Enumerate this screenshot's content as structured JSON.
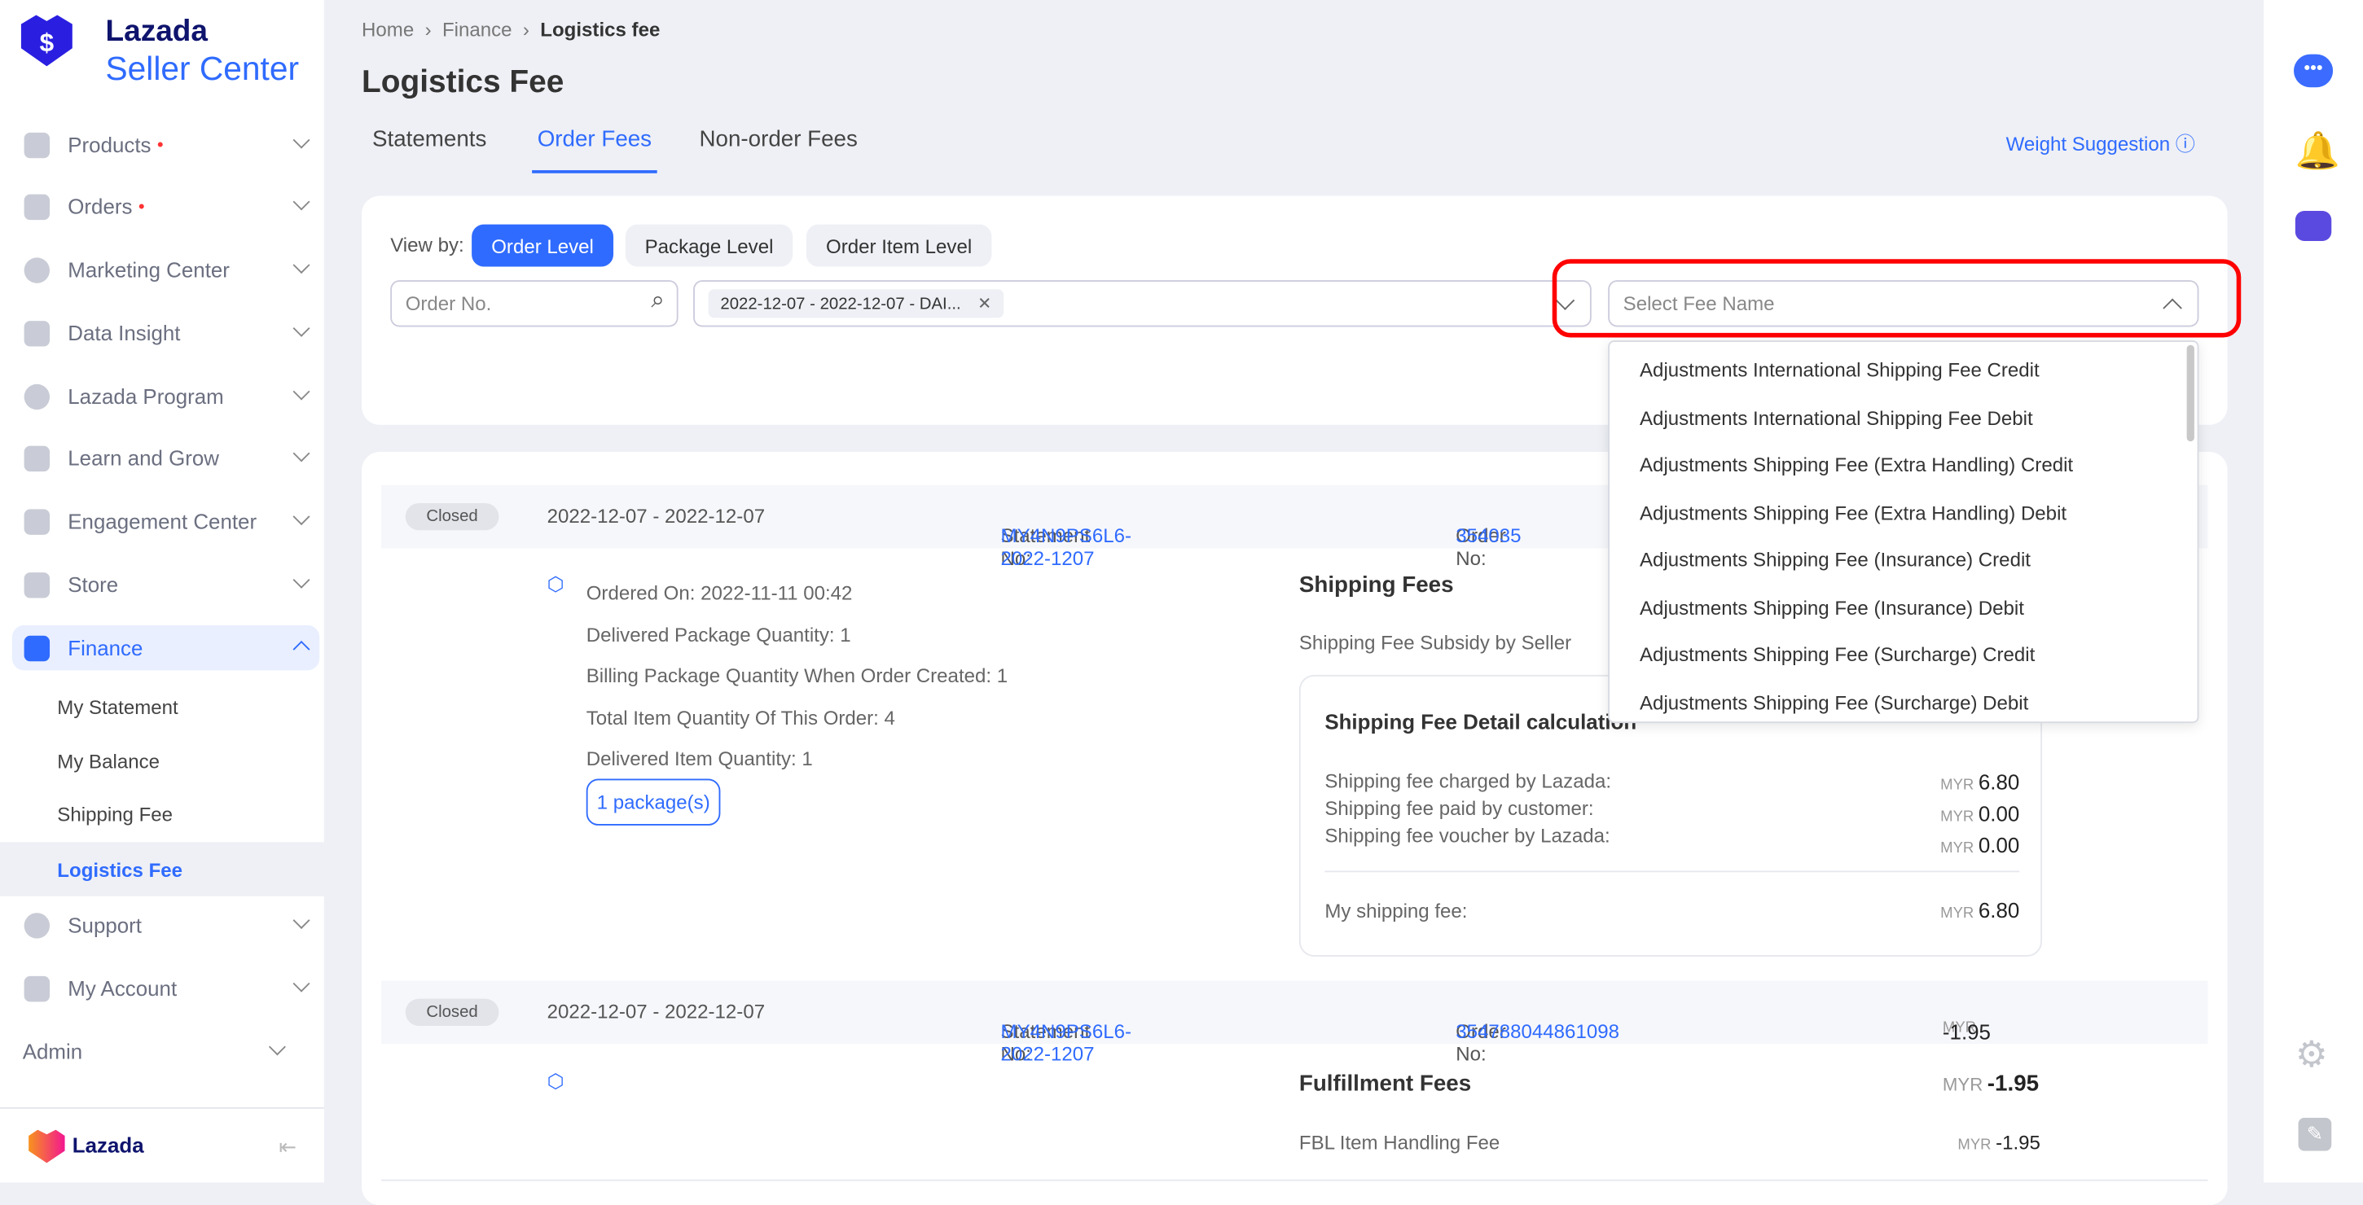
{
  "brand": {
    "line1": "Lazada",
    "line2": "Seller Center",
    "footer_logo": "Lazada"
  },
  "sidebar": {
    "items": [
      {
        "label": "Products",
        "dot": "•"
      },
      {
        "label": "Orders",
        "dot": "•"
      },
      {
        "label": "Marketing Center"
      },
      {
        "label": "Data Insight"
      },
      {
        "label": "Lazada Program"
      },
      {
        "label": "Learn and Grow"
      },
      {
        "label": "Engagement Center"
      },
      {
        "label": "Store"
      },
      {
        "label": "Finance"
      }
    ],
    "finance_sub": [
      "My Statement",
      "My Balance",
      "Shipping Fee",
      "Logistics Fee"
    ],
    "after": [
      {
        "label": "Support"
      },
      {
        "label": "My Account"
      }
    ],
    "admin": "Admin"
  },
  "breadcrumb": [
    "Home",
    "Finance",
    "Logistics fee"
  ],
  "page_title": "Logistics Fee",
  "tabs": [
    "Statements",
    "Order Fees",
    "Non-order Fees"
  ],
  "active_tab": "Order Fees",
  "weight_suggestion": "Weight Suggestion ⓘ",
  "filters": {
    "view_by": "View by:",
    "levels": [
      "Order Level",
      "Package Level",
      "Order Item Level"
    ],
    "order_no_placeholder": "Order No.",
    "date_tag": "2022-12-07 - 2022-12-07 - DAI...",
    "fee_name_placeholder": "Select Fee Name"
  },
  "fee_options": [
    "Adjustments International Shipping Fee Credit",
    "Adjustments International Shipping Fee Debit",
    "Adjustments Shipping Fee (Extra Handling) Credit",
    "Adjustments Shipping Fee (Extra Handling) Debit",
    "Adjustments Shipping Fee (Insurance) Credit",
    "Adjustments Shipping Fee (Insurance) Debit",
    "Adjustments Shipping Fee (Surcharge) Credit",
    "Adjustments Shipping Fee (Surcharge) Debit"
  ],
  "orders": [
    {
      "status": "Closed",
      "period": "2022-12-07 - 2022-12-07",
      "statement_label": "Statement No:",
      "statement_no": "MY4N9PS6L6-2022-1207",
      "order_label": "Order No:",
      "order_no": "354035",
      "details": [
        "Ordered On:  2022-11-11 00:42",
        "Delivered Package Quantity:  1",
        "Billing Package Quantity When Order Created:  1",
        "Total Item Quantity Of This Order:  4",
        "Delivered Item Quantity:  1"
      ],
      "packages": "1 package(s)",
      "section": "Shipping Fees",
      "subsidy": "Shipping Fee Subsidy by Seller",
      "calc": {
        "title": "Shipping Fee Detail calculation",
        "rows": [
          {
            "label": "Shipping fee charged by Lazada:",
            "value": "6.80"
          },
          {
            "label": "Shipping fee paid by customer:",
            "value": "0.00"
          },
          {
            "label": "Shipping fee voucher by Lazada:",
            "value": "0.00"
          }
        ],
        "total_label": "My shipping fee:",
        "total": "6.80"
      }
    },
    {
      "status": "Closed",
      "period": "2022-12-07 - 2022-12-07",
      "statement_label": "Statement No:",
      "statement_no": "MY4N9PS6L6-2022-1207",
      "order_label": "Order No:",
      "order_no": "354788044861098",
      "amount": "-1.95",
      "section": "Fulfillment Fees",
      "section_amount": "-1.95",
      "fee_label": "FBL Item Handling Fee",
      "fee_amount": "-1.95"
    }
  ],
  "currency": "MYR",
  "colors": {
    "accent": "#2f6bff",
    "highlight": "#ff0000"
  }
}
